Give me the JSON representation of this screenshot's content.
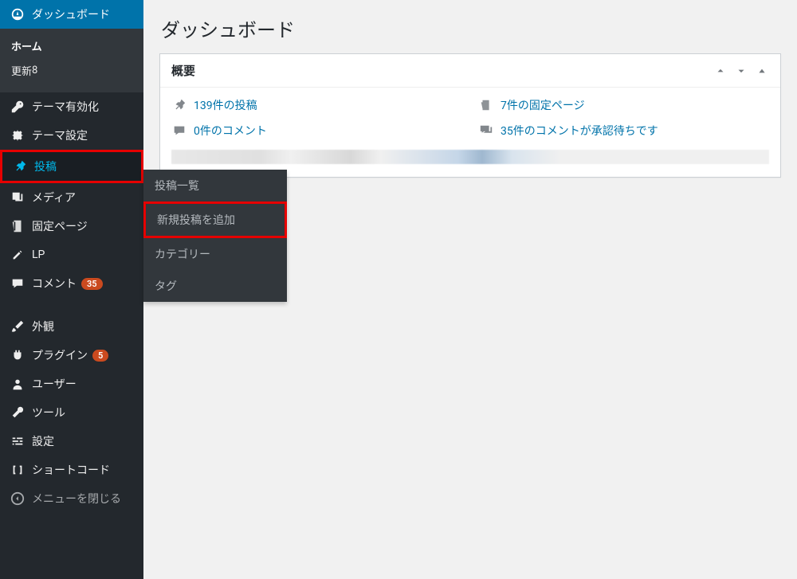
{
  "sidebar": {
    "dashboard": {
      "label": "ダッシュボード"
    },
    "home": {
      "label": "ホーム"
    },
    "updates": {
      "label": "更新",
      "badge": "8"
    },
    "theme_activation": {
      "label": "テーマ有効化"
    },
    "theme_settings": {
      "label": "テーマ設定"
    },
    "posts": {
      "label": "投稿"
    },
    "media": {
      "label": "メディア"
    },
    "pages": {
      "label": "固定ページ"
    },
    "lp": {
      "label": "LP"
    },
    "comments": {
      "label": "コメント",
      "badge": "35"
    },
    "appearance": {
      "label": "外観"
    },
    "plugins": {
      "label": "プラグイン",
      "badge": "5"
    },
    "users": {
      "label": "ユーザー"
    },
    "tools": {
      "label": "ツール"
    },
    "settings": {
      "label": "設定"
    },
    "shortcode": {
      "label": "ショートコード"
    },
    "collapse": {
      "label": "メニューを閉じる"
    }
  },
  "flyout": {
    "posts_list": "投稿一覧",
    "add_new": "新規投稿を追加",
    "categories": "カテゴリー",
    "tags": "タグ"
  },
  "main": {
    "page_title": "ダッシュボード",
    "panel": {
      "title": "概要",
      "stats": {
        "posts": "139件の投稿",
        "pages": "7件の固定ページ",
        "comments": "0件のコメント",
        "pending_comments": "35件のコメントが承認待ちです"
      }
    }
  }
}
